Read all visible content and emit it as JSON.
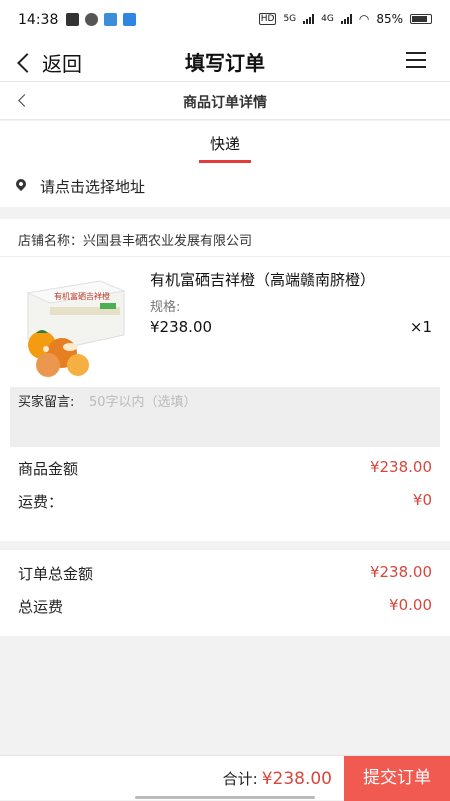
{
  "status_bar": {
    "time": "14:38",
    "network_1": "5G",
    "network_2": "4G",
    "battery": "85%"
  },
  "nav": {
    "back_label": "返回",
    "title": "填写订单"
  },
  "subnav": {
    "title": "商品订单详情"
  },
  "tabs": [
    {
      "label": "快递",
      "active": true
    }
  ],
  "address": {
    "placeholder": "请点击选择地址"
  },
  "shop": {
    "name": "店铺名称：兴国县丰硒农业发展有限公司"
  },
  "product": {
    "name": "有机富硒吉祥橙（高端赣南脐橙）",
    "spec": "规格:",
    "price": "¥238.00",
    "qty": "×1",
    "box_text": "有机富硒吉祥橙"
  },
  "message": {
    "label": "买家留言:",
    "placeholder": "50字以内（选填）"
  },
  "amounts": [
    {
      "label": "商品金额",
      "value": "¥238.00"
    },
    {
      "label": "运费：",
      "value": "¥0"
    }
  ],
  "totals": [
    {
      "label": "订单总金额",
      "value": "¥238.00"
    },
    {
      "label": "总运费",
      "value": "¥0.00"
    }
  ],
  "footer": {
    "total_label": "合计:",
    "total_value": "¥238.00",
    "submit_label": "提交订单"
  },
  "colors": {
    "accent": "#e33a3a",
    "price": "#d9463c",
    "submit_bg": "#f15a50"
  }
}
